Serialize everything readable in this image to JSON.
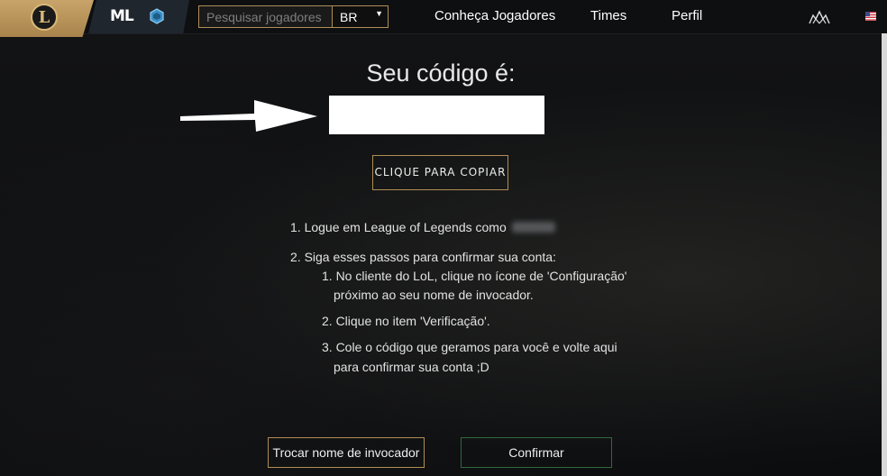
{
  "header": {
    "logo_letter": "L",
    "ml_logo": "ML",
    "search": {
      "placeholder": "Pesquisar jogadores",
      "value": ""
    },
    "region": {
      "selected": "BR",
      "caret": "▼"
    },
    "nav": [
      {
        "label": "Conheça Jogadores"
      },
      {
        "label": "Times"
      },
      {
        "label": "Perfil"
      }
    ],
    "icons": [
      "league-of-legends-logo-icon",
      "ml-logo-icon",
      "gem-icon",
      "people-icon",
      "us-flag-icon"
    ],
    "accent_color": "#b08e55"
  },
  "main": {
    "title": "Seu código é:",
    "code_value": "",
    "copy_label": "CLIQUE PARA COPIAR",
    "steps": {
      "step1": "1. Logue em League of Legends como",
      "step2": "2. Siga esses passos para confirmar sua conta:",
      "sub1_line1": "1. No cliente do LoL, clique no ícone de 'Configuração'",
      "sub1_line2": "próximo ao seu nome de invocador.",
      "sub2": "2. Clique no item 'Verificação'.",
      "sub3_line1": "3. Cole o código que geramos para você e volte aqui",
      "sub3_line2": "para confirmar sua conta ;D"
    },
    "buttons": {
      "swap_label": "Trocar nome de invocador",
      "confirm_label": "Confirmar"
    },
    "confirm_border_color": "#2e6a3c"
  }
}
